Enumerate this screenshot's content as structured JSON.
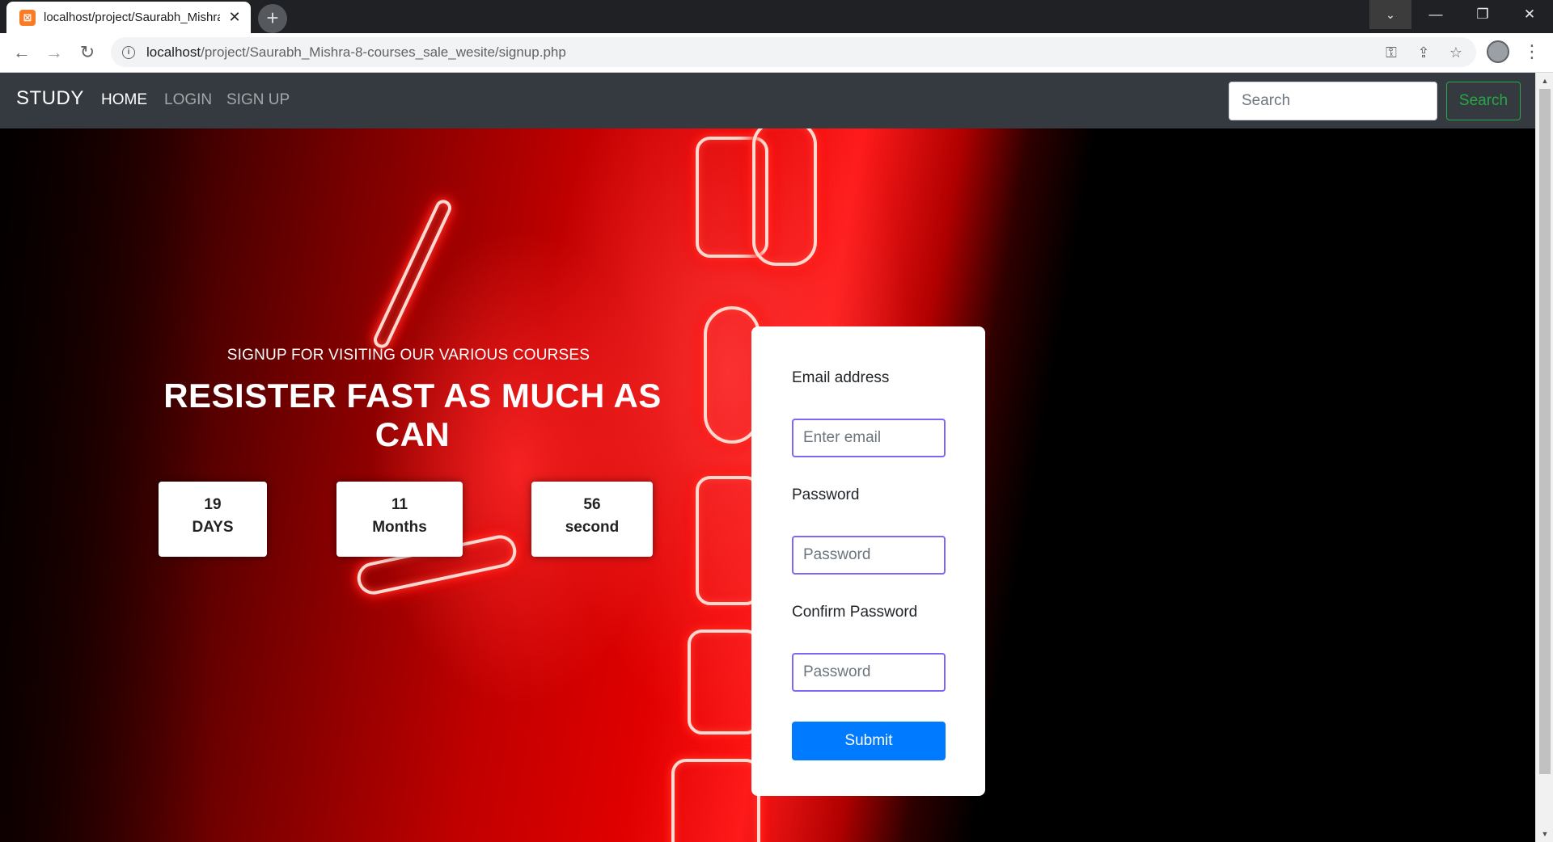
{
  "browser": {
    "tab_title": "localhost/project/Saurabh_Mishra-8-courses_sale_wesite/signup.php",
    "url_host": "localhost",
    "url_path": "/project/Saurabh_Mishra-8-courses_sale_wesite/signup.php"
  },
  "navbar": {
    "brand": "STUDY",
    "links": [
      "HOME",
      "LOGIN",
      "SIGN UP"
    ],
    "search_placeholder": "Search",
    "search_button": "Search"
  },
  "hero": {
    "subtitle": "SIGNUP FOR VISITING OUR VARIOUS COURSES",
    "title": "RESISTER FAST AS MUCH AS CAN",
    "countdown": [
      {
        "value": "19",
        "unit": "DAYS"
      },
      {
        "value": "11",
        "unit": "Months"
      },
      {
        "value": "56",
        "unit": "second"
      }
    ]
  },
  "form": {
    "email_label": "Email address",
    "email_placeholder": "Enter email",
    "password_label": "Password",
    "password_placeholder": "Password",
    "confirm_label": "Confirm Password",
    "confirm_placeholder": "Password",
    "submit_label": "Submit"
  },
  "colors": {
    "navbar_bg": "#343a40",
    "search_accent": "#28a745",
    "submit_bg": "#007bff",
    "field_border": "#8066f2"
  }
}
